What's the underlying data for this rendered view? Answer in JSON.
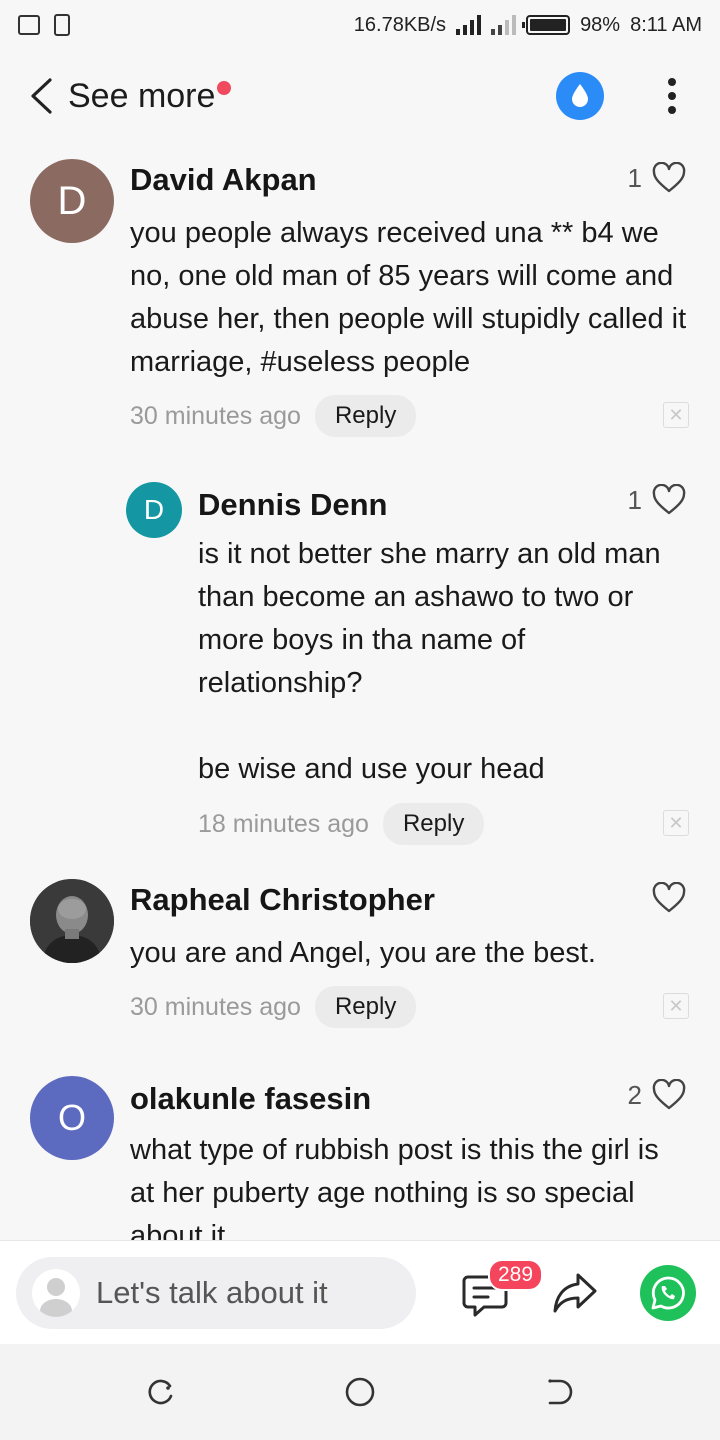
{
  "status": {
    "speed": "16.78KB/s",
    "battery": "98%",
    "time": "8:11 AM"
  },
  "header": {
    "back_label": "See more"
  },
  "comments": [
    {
      "author": "David Akpan",
      "avatar_letter": "D",
      "avatar_color": "#8b6b61",
      "likes": "1",
      "text": "you people always received una ** b4 we no, one old man of 85 years will come and abuse her, then people will stupidly called it marriage, #useless people",
      "time": "30 minutes ago",
      "reply_label": "Reply"
    },
    {
      "author": "Dennis Denn",
      "avatar_letter": "D",
      "avatar_color": "#1497a3",
      "likes": "1",
      "text": "is it not better she marry an old man than become an ashawo to two or more boys in tha name of relationship?\n\nbe wise and use your head",
      "time": "18 minutes ago",
      "reply_label": "Reply"
    },
    {
      "author": "Rapheal Christopher",
      "likes": "",
      "text": "you are and Angel, you are the best.",
      "time": "30 minutes ago",
      "reply_label": "Reply"
    },
    {
      "author": "olakunle fasesin",
      "avatar_letter": "O",
      "avatar_color": "#5c6bc0",
      "likes": "2",
      "text": "what type of rubbish post is this the girl is at her puberty age nothing is so special about it"
    }
  ],
  "bottom": {
    "input_placeholder": "Let's talk about it",
    "comment_count": "289"
  }
}
